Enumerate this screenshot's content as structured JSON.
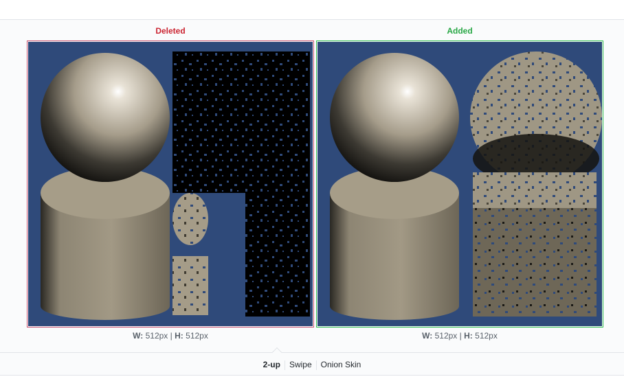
{
  "views": {
    "deleted": {
      "label": "Deleted",
      "w_label": "W:",
      "w_value": "512px",
      "divider": "|",
      "h_label": "H:",
      "h_value": "512px"
    },
    "added": {
      "label": "Added",
      "w_label": "W:",
      "w_value": "512px",
      "divider": "|",
      "h_label": "H:",
      "h_value": "512px"
    }
  },
  "modes": {
    "two_up": "2-up",
    "swipe": "Swipe",
    "onion_skin": "Onion Skin",
    "active": "2-up"
  },
  "colors": {
    "deleted": "#cb2431",
    "added": "#28a745",
    "scene_background": "#2f4a7a"
  }
}
